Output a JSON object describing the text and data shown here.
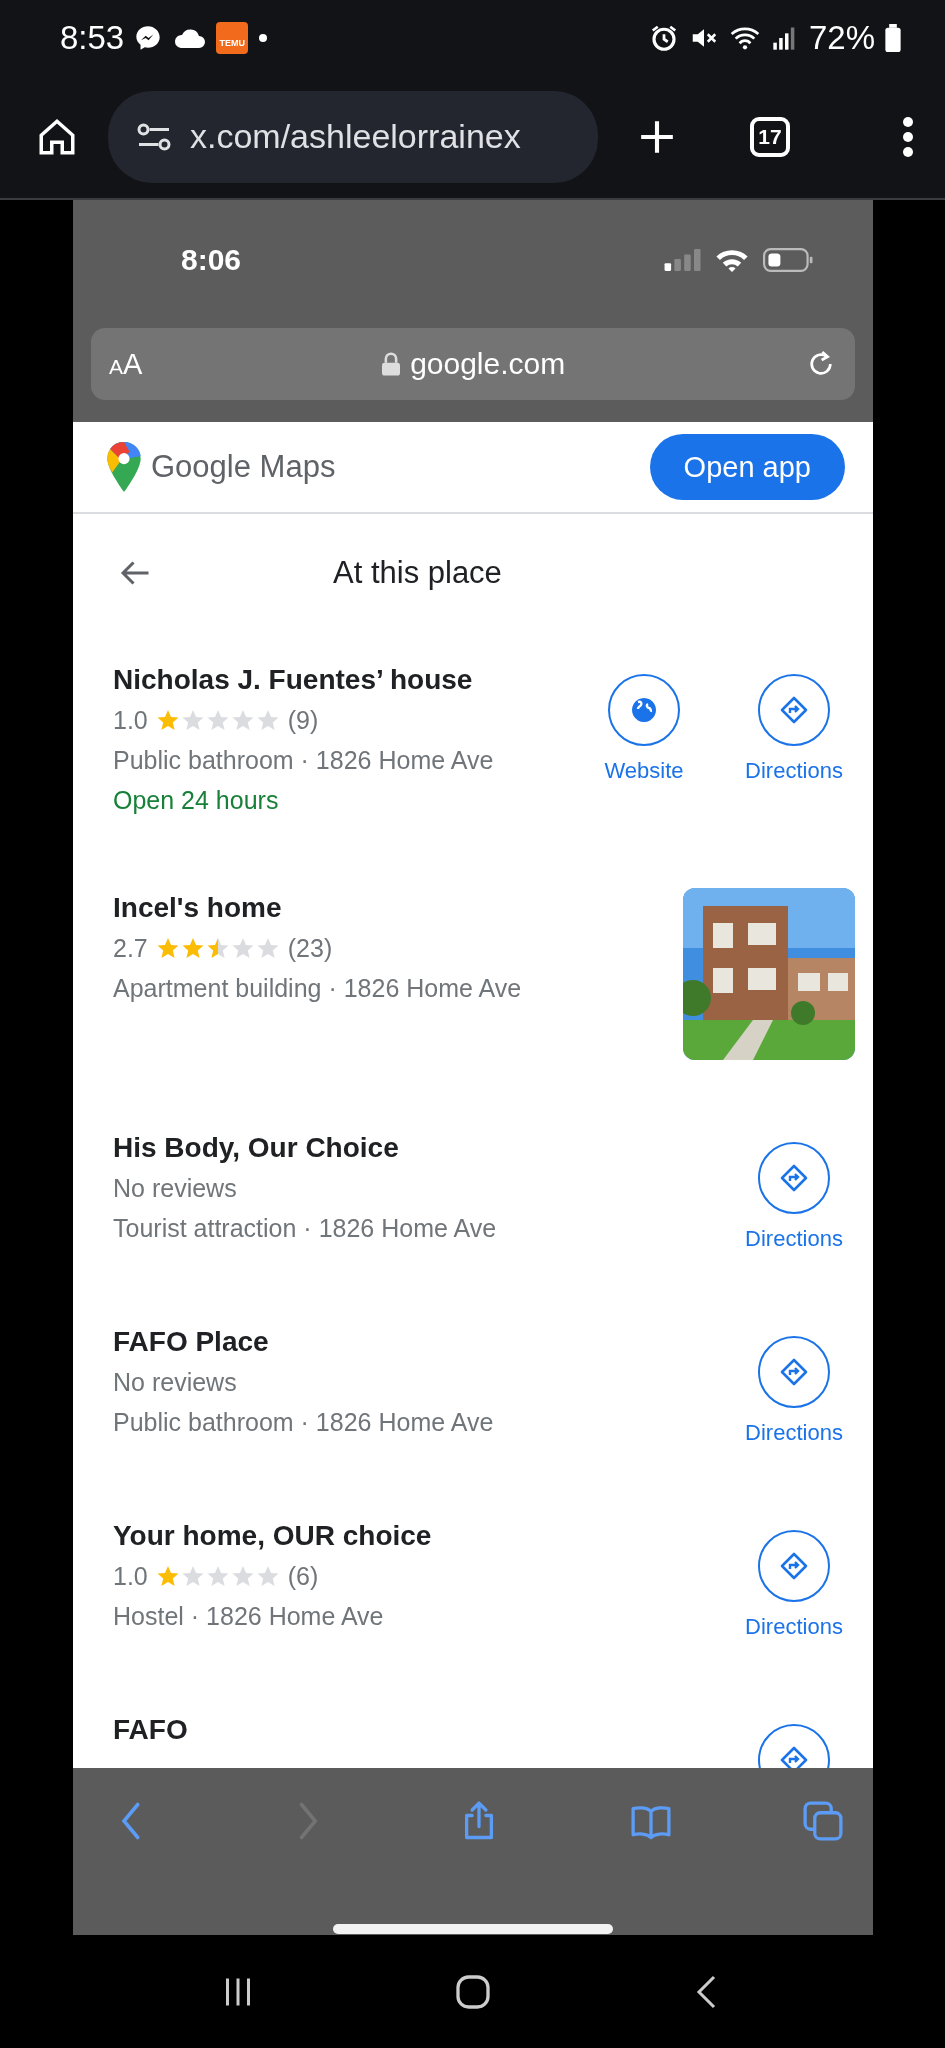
{
  "android_status": {
    "time": "8:53",
    "notification_badge": "TEMU",
    "battery": "72%"
  },
  "chrome": {
    "url": "x.com/ashleelorrainex",
    "tab_count": "17"
  },
  "ios_status": {
    "time": "8:06"
  },
  "safari": {
    "text_size_button": "AA",
    "domain": "google.com",
    "toolbar": [
      {
        "kind": "back",
        "disabled": false
      },
      {
        "kind": "forward",
        "disabled": true
      },
      {
        "kind": "share",
        "disabled": false
      },
      {
        "kind": "bookmarks",
        "disabled": false
      },
      {
        "kind": "tabs",
        "disabled": false
      }
    ]
  },
  "maps": {
    "logo_text": "Google Maps",
    "open_app_button": "Open app",
    "heading": "At this place",
    "places": [
      {
        "name": "Nicholas J. Fuentes’ house",
        "rating": "1.0",
        "stars": 1,
        "review_count": "(9)",
        "details": "Public bathroom · 1826 Home Ave",
        "hours": "Open 24 hours",
        "actions": [
          {
            "kind": "website",
            "label": "Website"
          },
          {
            "kind": "directions",
            "label": "Directions"
          }
        ]
      },
      {
        "name": "Incel's home",
        "rating": "2.7",
        "stars": 2.5,
        "review_count": "(23)",
        "details": "Apartment building · 1826 Home Ave"
      },
      {
        "name": "His Body, Our Choice",
        "reviews_note": "No reviews",
        "details": "Tourist attraction · 1826 Home Ave",
        "actions": [
          {
            "kind": "directions",
            "label": "Directions"
          }
        ]
      },
      {
        "name": "FAFO Place",
        "reviews_note": "No reviews",
        "details": "Public bathroom · 1826 Home Ave",
        "actions": [
          {
            "kind": "directions",
            "label": "Directions"
          }
        ]
      },
      {
        "name": "Your home, OUR choice",
        "rating": "1.0",
        "stars": 1,
        "review_count": "(6)",
        "details": "Hostel · 1826 Home Ave",
        "actions": [
          {
            "kind": "directions",
            "label": "Directions"
          }
        ]
      },
      {
        "name": "FAFO",
        "actions": [
          {
            "kind": "directions"
          }
        ]
      }
    ]
  }
}
